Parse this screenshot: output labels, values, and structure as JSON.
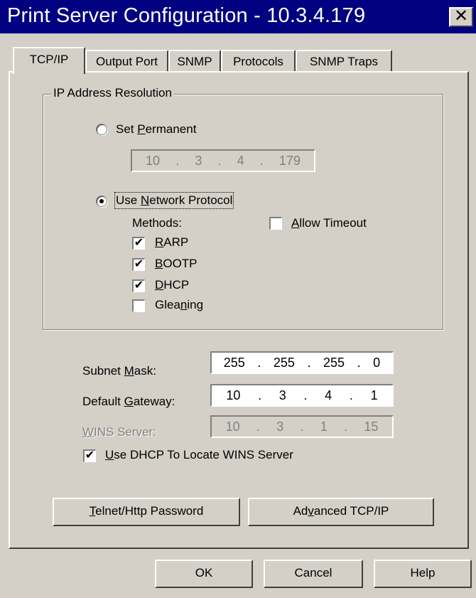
{
  "window": {
    "title": "Print Server Configuration - 10.3.4.179",
    "close_glyph": "✕"
  },
  "tabs": [
    {
      "label": "TCP/IP",
      "active": true
    },
    {
      "label": "Output Port",
      "active": false
    },
    {
      "label": "SNMP",
      "active": false
    },
    {
      "label": "Protocols",
      "active": false
    },
    {
      "label": "SNMP Traps",
      "active": false
    }
  ],
  "ip_resolution": {
    "group_label": "IP Address Resolution",
    "set_permanent": {
      "label_pre": "Set ",
      "label_access": "P",
      "label_post": "ermanent",
      "selected": false
    },
    "permanent_ip": [
      "10",
      "3",
      "4",
      "179"
    ],
    "use_network": {
      "label_pre": "Use ",
      "label_access": "N",
      "label_post": "etwork Protocol",
      "selected": true
    },
    "methods_label": "Methods:",
    "allow_timeout": {
      "label_pre": "",
      "label_access": "A",
      "label_post": "llow Timeout",
      "checked": false
    },
    "methods": [
      {
        "label_pre": "",
        "label_access": "R",
        "label_post": "ARP",
        "checked": true
      },
      {
        "label_pre": "",
        "label_access": "B",
        "label_post": "OOTP",
        "checked": true
      },
      {
        "label_pre": "",
        "label_access": "D",
        "label_post": "HCP",
        "checked": true
      },
      {
        "label_pre": "Glea",
        "label_access": "n",
        "label_post": "ing",
        "checked": false
      }
    ]
  },
  "network": {
    "subnet": {
      "label_pre": "Subnet ",
      "label_access": "M",
      "label_post": "ask:",
      "value": [
        "255",
        "255",
        "255",
        "0"
      ]
    },
    "gateway": {
      "label_pre": "Default ",
      "label_access": "G",
      "label_post": "ateway:",
      "value": [
        "10",
        "3",
        "4",
        "1"
      ]
    },
    "wins": {
      "label_pre": "",
      "label_access": "W",
      "label_post": "INS Server:",
      "value": [
        "10",
        "3",
        "1",
        "15"
      ],
      "disabled": true
    },
    "use_dhcp_wins": {
      "label_pre": "",
      "label_access": "U",
      "label_post": "se DHCP To Locate WINS Server",
      "checked": true
    }
  },
  "buttons": {
    "telnet": {
      "label_pre": "",
      "label_access": "T",
      "label_post": "elnet/Http Password"
    },
    "advanced": {
      "label_pre": "Ad",
      "label_access": "v",
      "label_post": "anced TCP/IP"
    },
    "ok": "OK",
    "cancel": "Cancel",
    "help": "Help"
  },
  "icons": {
    "check_glyph": "✔",
    "ip_separator": "."
  },
  "colors": {
    "titlebar": "#000080",
    "face": "#d4d0c8"
  }
}
